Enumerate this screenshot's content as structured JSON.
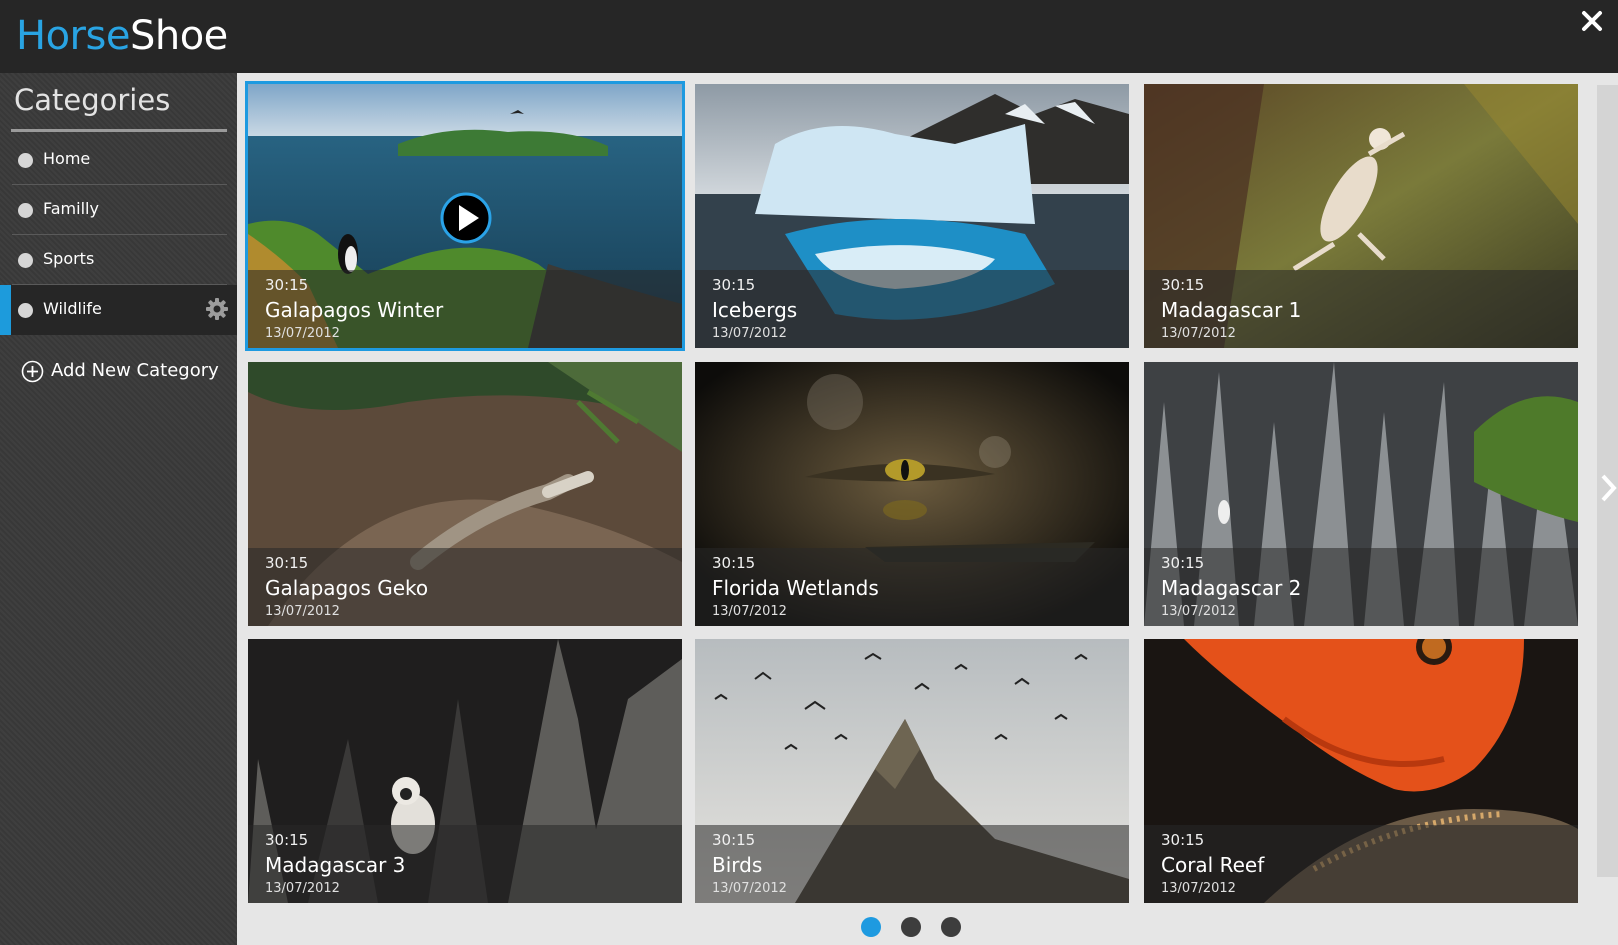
{
  "app": {
    "title_part1": "Horse",
    "title_part2": "Shoe",
    "accent": "#1e9ae0"
  },
  "header": {
    "close_icon": "close-icon"
  },
  "sidebar": {
    "title": "Categories",
    "items": [
      {
        "label": "Home",
        "active": false
      },
      {
        "label": "Familly",
        "active": false
      },
      {
        "label": "Sports",
        "active": false
      },
      {
        "label": "Wildlife",
        "active": true
      }
    ],
    "add_label": "Add New Category"
  },
  "videos": [
    {
      "duration": "30:15",
      "title": "Galapagos Winter",
      "date": "13/07/2012",
      "selected": true
    },
    {
      "duration": "30:15",
      "title": "Icebergs",
      "date": "13/07/2012",
      "selected": false
    },
    {
      "duration": "30:15",
      "title": "Madagascar 1",
      "date": "13/07/2012",
      "selected": false
    },
    {
      "duration": "30:15",
      "title": "Galapagos Geko",
      "date": "13/07/2012",
      "selected": false
    },
    {
      "duration": "30:15",
      "title": "Florida Wetlands",
      "date": "13/07/2012",
      "selected": false
    },
    {
      "duration": "30:15",
      "title": "Madagascar 2",
      "date": "13/07/2012",
      "selected": false
    },
    {
      "duration": "30:15",
      "title": "Madagascar 3",
      "date": "13/07/2012",
      "selected": false
    },
    {
      "duration": "30:15",
      "title": "Birds",
      "date": "13/07/2012",
      "selected": false
    },
    {
      "duration": "30:15",
      "title": "Coral Reef",
      "date": "13/07/2012",
      "selected": false
    }
  ],
  "pagination": {
    "pages": 3,
    "current": 1
  }
}
